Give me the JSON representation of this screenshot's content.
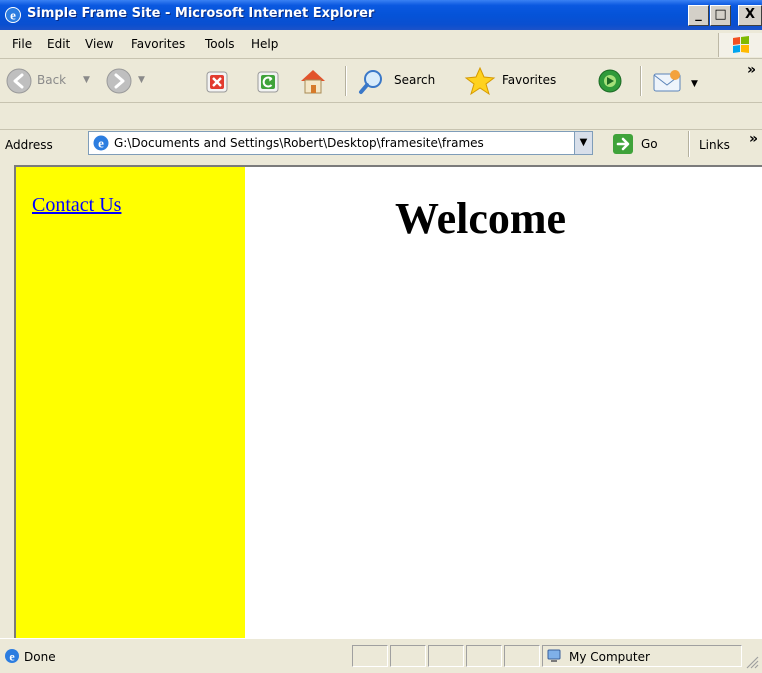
{
  "window": {
    "title": "Simple Frame Site - Microsoft Internet Explorer",
    "minimize_glyph": "_",
    "maximize_glyph": "□",
    "close_glyph": "X"
  },
  "menu": {
    "items": [
      "File",
      "Edit",
      "View",
      "Favorites",
      "Tools",
      "Help"
    ]
  },
  "toolbar": {
    "back_label": "Back",
    "search_label": "Search",
    "favorites_label": "Favorites",
    "overflow_glyph": "»"
  },
  "address": {
    "label": "Address",
    "value": "G:\\Documents and Settings\\Robert\\Desktop\\framesite\\frames",
    "go_label": "Go",
    "links_label": "Links",
    "links_overflow": "»"
  },
  "page": {
    "left_frame_bg": "#ffff00",
    "contact_link": "Contact Us",
    "heading": "Welcome"
  },
  "status": {
    "text": "Done",
    "zone": "My Computer"
  },
  "colors": {
    "titlebar": "#0553d8",
    "link": "#0000ff"
  }
}
